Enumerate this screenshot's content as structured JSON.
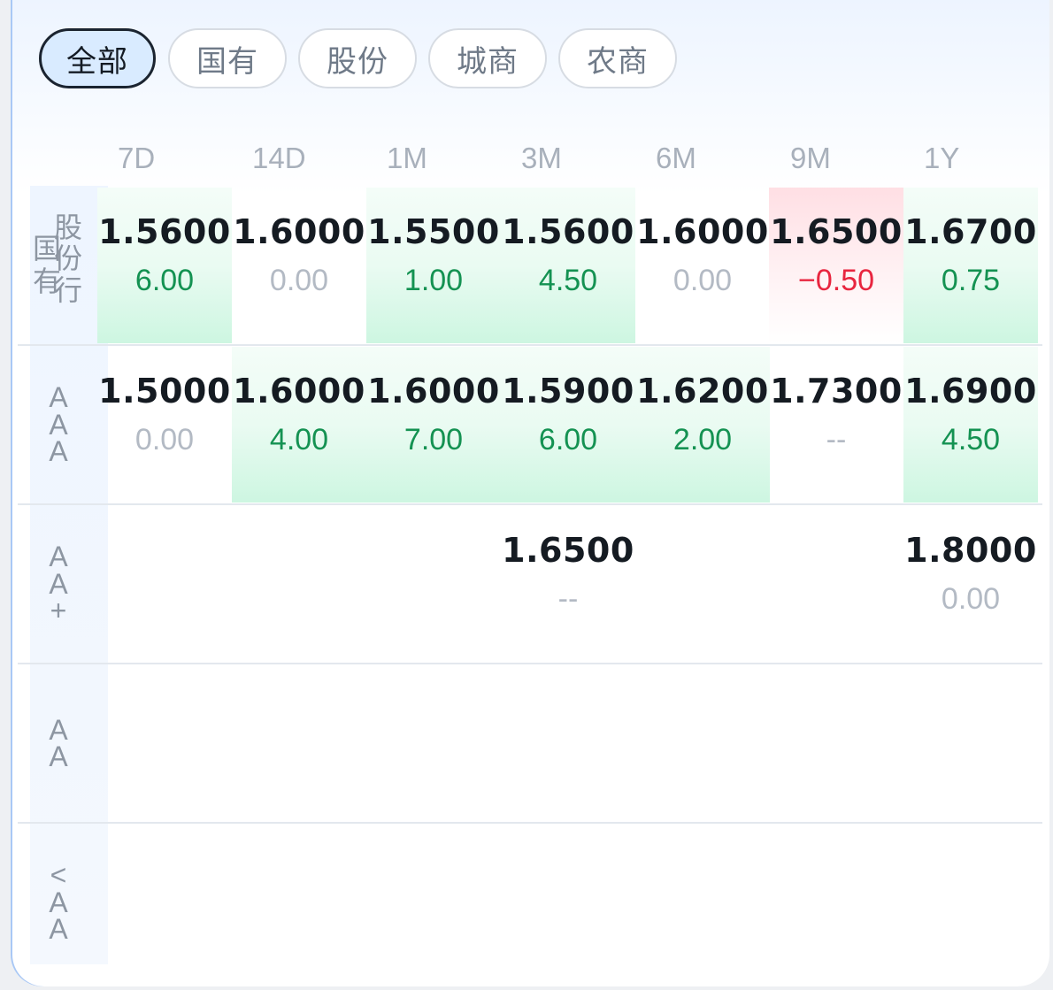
{
  "tabs": [
    {
      "label": "全部",
      "active": true
    },
    {
      "label": "国有",
      "active": false
    },
    {
      "label": "股份",
      "active": false
    },
    {
      "label": "城商",
      "active": false
    },
    {
      "label": "农商",
      "active": false
    }
  ],
  "columns": [
    "7D",
    "14D",
    "1M",
    "3M",
    "6M",
    "9M",
    "1Y"
  ],
  "rows": [
    {
      "label_a": "国有",
      "label_b": "股份行",
      "cells": [
        {
          "rate": "1.5600",
          "change": "6.00",
          "trend": "up"
        },
        {
          "rate": "1.6000",
          "change": "0.00",
          "trend": "flat"
        },
        {
          "rate": "1.5500",
          "change": "1.00",
          "trend": "up"
        },
        {
          "rate": "1.5600",
          "change": "4.50",
          "trend": "up"
        },
        {
          "rate": "1.6000",
          "change": "0.00",
          "trend": "flat"
        },
        {
          "rate": "1.6500",
          "change": "−0.50",
          "trend": "down"
        },
        {
          "rate": "1.6700",
          "change": "0.75",
          "trend": "up"
        }
      ]
    },
    {
      "label": "AAA",
      "cells": [
        {
          "rate": "1.5000",
          "change": "0.00",
          "trend": "flat"
        },
        {
          "rate": "1.6000",
          "change": "4.00",
          "trend": "up"
        },
        {
          "rate": "1.6000",
          "change": "7.00",
          "trend": "up"
        },
        {
          "rate": "1.5900",
          "change": "6.00",
          "trend": "up"
        },
        {
          "rate": "1.6200",
          "change": "2.00",
          "trend": "up"
        },
        {
          "rate": "1.7300",
          "change": "--",
          "trend": "flat"
        },
        {
          "rate": "1.6900",
          "change": "4.50",
          "trend": "up"
        }
      ]
    },
    {
      "label": "AA+",
      "cells": [
        null,
        null,
        null,
        {
          "rate": "1.6500",
          "change": "--",
          "trend": "flat"
        },
        null,
        null,
        {
          "rate": "1.8000",
          "change": "0.00",
          "trend": "flat"
        }
      ]
    },
    {
      "label": "AA",
      "cells": [
        null,
        null,
        null,
        null,
        null,
        null,
        null
      ]
    },
    {
      "label": "<AA",
      "cells": [
        null,
        null,
        null,
        null,
        null,
        null,
        null
      ]
    }
  ],
  "colors": {
    "up": "#149252",
    "down": "#e8253f",
    "flat": "#b3bac4",
    "active_tab_bg": "#d9ebff"
  }
}
